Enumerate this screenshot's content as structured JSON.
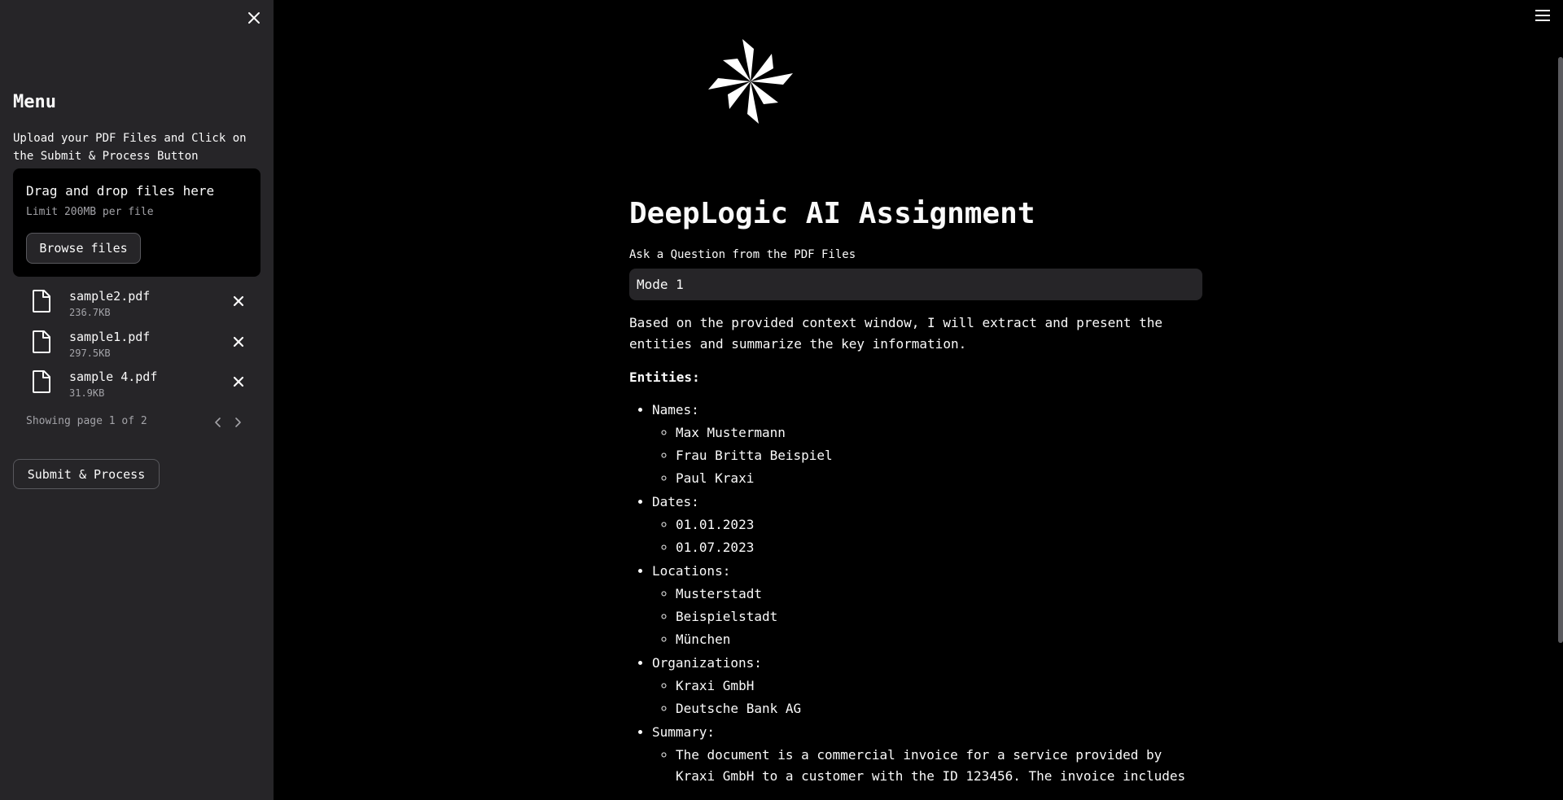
{
  "sidebar": {
    "title": "Menu",
    "description": "Upload your PDF Files and Click on the Submit & Process Button",
    "dropzone": {
      "title": "Drag and drop files here",
      "limit": "Limit 200MB per file",
      "browse_label": "Browse files"
    },
    "files": [
      {
        "name": "sample2.pdf",
        "size": "236.7KB"
      },
      {
        "name": "sample1.pdf",
        "size": "297.5KB"
      },
      {
        "name": "sample 4.pdf",
        "size": "31.9KB"
      }
    ],
    "pager_text": "Showing page 1 of 2",
    "submit_label": "Submit & Process"
  },
  "main": {
    "title": "DeepLogic AI Assignment",
    "question_label": "Ask a Question from the PDF Files",
    "question_value": "Mode 1",
    "answer": {
      "intro": "Based on the provided context window, I will extract and present the entities and summarize the key information.",
      "entities_heading": "Entities:",
      "groups": [
        {
          "label": "Names:",
          "items": [
            "Max Mustermann",
            "Frau Britta Beispiel",
            "Paul Kraxi"
          ]
        },
        {
          "label": "Dates:",
          "items": [
            "01.01.2023",
            "01.07.2023"
          ]
        },
        {
          "label": "Locations:",
          "items": [
            "Musterstadt",
            "Beispielstadt",
            "München"
          ]
        },
        {
          "label": "Organizations:",
          "items": [
            "Kraxi GmbH",
            "Deutsche Bank AG"
          ]
        },
        {
          "label": "Summary:",
          "items": [
            "The document is a commercial invoice for a service provided by Kraxi GmbH to a customer with the ID 123456. The invoice includes"
          ]
        }
      ]
    }
  },
  "colors": {
    "sidebar_bg": "#262528",
    "main_bg": "#000000",
    "text": "#fafafa",
    "muted_text": "#a3a3a8"
  },
  "icons": [
    "close-icon",
    "file-icon",
    "chevron-left-icon",
    "chevron-right-icon",
    "hamburger-icon",
    "logo-icon"
  ]
}
